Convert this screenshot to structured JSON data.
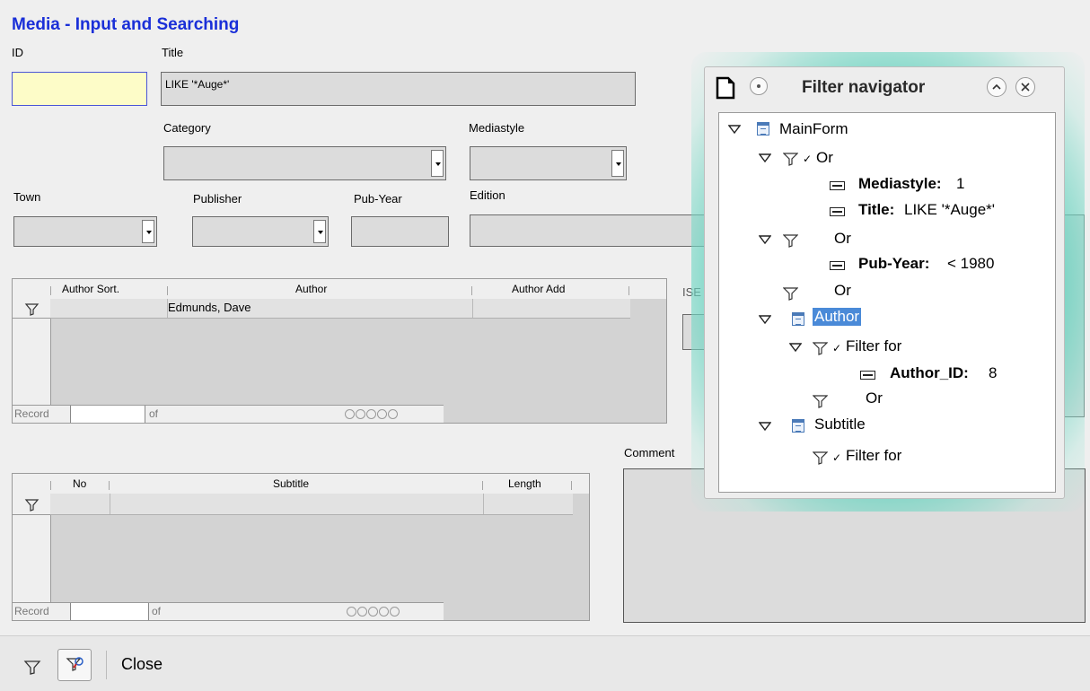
{
  "form": {
    "title": "Media - Input and Searching",
    "labels": {
      "id": "ID",
      "title": "Title",
      "category": "Category",
      "mediastyle": "Mediastyle",
      "town": "Town",
      "publisher": "Publisher",
      "pub_year": "Pub-Year",
      "edition": "Edition",
      "isbn_partial": "ISE",
      "comment": "Comment"
    },
    "values": {
      "title": "LIKE '*Auge*'"
    }
  },
  "author_grid": {
    "columns": [
      "Author Sort.",
      "Author",
      "Author Add"
    ],
    "rows": [
      [
        "",
        "Edmunds, Dave",
        ""
      ]
    ],
    "nav": {
      "record": "Record",
      "of": "of"
    }
  },
  "subtitle_grid": {
    "columns": [
      "No",
      "Subtitle",
      "Length"
    ],
    "rows": [
      [
        "",
        "",
        ""
      ]
    ],
    "nav": {
      "record": "Record",
      "of": "of"
    }
  },
  "bottombar": {
    "close": "Close"
  },
  "filter_navigator": {
    "title": "Filter navigator",
    "tree": {
      "mainform": "MainForm",
      "or1": "Or",
      "mediastyle_key": "Mediastyle:",
      "mediastyle_val": "1",
      "title_key": "Title:",
      "title_val": "LIKE '*Auge*'",
      "or2": "Or",
      "pubyear_key": "Pub-Year:",
      "pubyear_val": "< 1980",
      "or3": "Or",
      "author": "Author",
      "filter_for1": "Filter for",
      "authorid_key": "Author_ID:",
      "authorid_val": "8",
      "or4": "Or",
      "subtitle": "Subtitle",
      "filter_for2": "Filter for"
    }
  },
  "colors": {
    "title_blue": "#1a2fd8",
    "highlight": "#4a8ad8",
    "glow": "#64d2be"
  }
}
